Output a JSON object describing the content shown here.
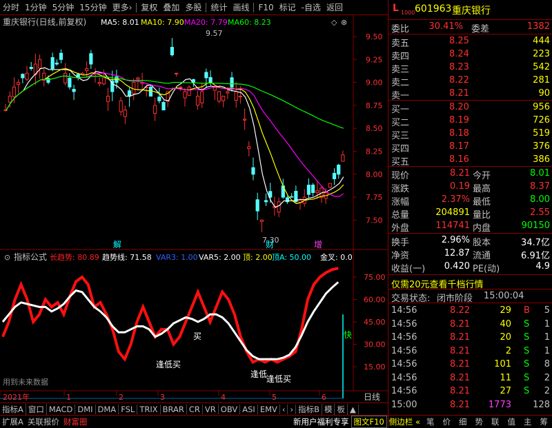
{
  "topbar": {
    "items": [
      "分时",
      "1分钟",
      "5分钟",
      "15分钟",
      "更多›",
      "复权",
      "叠加",
      "多股",
      "统计",
      "画线",
      "F10",
      "标记",
      "-自选",
      "返回"
    ]
  },
  "main": {
    "title": "重庆银行(日线,前复权)",
    "ma": [
      {
        "label": "MA5: 8.01",
        "color": "#ffffff"
      },
      {
        "label": "MA10: 7.90",
        "color": "#ffff00"
      },
      {
        "label": "MA20: 7.79",
        "color": "#ff00ff"
      },
      {
        "label": "MA60: 8.23",
        "color": "#00ff00"
      }
    ],
    "y_ticks": [
      "9.50",
      "9.25",
      "9.00",
      "8.75",
      "8.50",
      "8.25",
      "8.00",
      "7.75",
      "7.50"
    ],
    "high_label": "9.57",
    "low_label": "7.30",
    "markers": [
      "解",
      "财",
      "增"
    ]
  },
  "ind": {
    "title": "指标公式",
    "vals": [
      {
        "label": "长趋势: 80.89",
        "color": "#ff2020"
      },
      {
        "label": "趋势线: 71.58",
        "color": "#ffffff"
      },
      {
        "label": "VAR3: 1.00",
        "color": "#3060ff"
      },
      {
        "label": "VAR5: 2.00",
        "color": "#ffffff"
      },
      {
        "label": "顶: 2.00",
        "color": "#ffff00"
      },
      {
        "label": "顶A: 50.00",
        "color": "#00ffff"
      },
      {
        "label": "金叉: 0.0",
        "color": "#ffffff"
      }
    ],
    "y_ticks": [
      "75.00",
      "60.00",
      "45.00",
      "30.00",
      "15.00"
    ],
    "buy1": "逢低买",
    "buy2": "逢低",
    "buy3": "逢低买",
    "buy4": "买",
    "fast": "快",
    "note": "用到未来数据"
  },
  "xaxis": {
    "labels": [
      "2021年",
      "1",
      "2",
      "3",
      "4",
      "5",
      "6"
    ],
    "daily": "日线"
  },
  "indtabs": [
    "指标A",
    "窗口",
    "MACD",
    "DMI",
    "DMA",
    "FSL",
    "TRIX",
    "BRAR",
    "CR",
    "VR",
    "OBV",
    "ASI",
    "EMV",
    "‹",
    "›",
    "指标B",
    "模",
    "板",
    "▲"
  ],
  "status": {
    "left": [
      "扩展A",
      "关联报价",
      "财富圈"
    ],
    "promo": "新用户福利专享",
    "f10": "图文F10",
    "side": "侧边栏 «",
    "right": [
      "笔",
      "价",
      "细",
      "势",
      "联",
      "值",
      "主",
      "筹"
    ]
  },
  "quote": {
    "code": "601963",
    "name": "重庆银行",
    "wb_label": "委比",
    "wb": "30.41%",
    "wc_label": "委差",
    "wc": "1382",
    "asks": [
      {
        "l": "卖五",
        "p": "8.25",
        "v": "444"
      },
      {
        "l": "卖四",
        "p": "8.24",
        "v": "223"
      },
      {
        "l": "卖三",
        "p": "8.23",
        "v": "542"
      },
      {
        "l": "卖二",
        "p": "8.22",
        "v": "281"
      },
      {
        "l": "卖一",
        "p": "8.21",
        "v": "90"
      }
    ],
    "bids": [
      {
        "l": "买一",
        "p": "8.20",
        "v": "956"
      },
      {
        "l": "买二",
        "p": "8.19",
        "v": "726"
      },
      {
        "l": "买三",
        "p": "8.18",
        "v": "519"
      },
      {
        "l": "买四",
        "p": "8.17",
        "v": "376"
      },
      {
        "l": "买五",
        "p": "8.16",
        "v": "386"
      }
    ],
    "stats": [
      {
        "l1": "现价",
        "v1": "8.21",
        "c1": "#ff3030",
        "l2": "今开",
        "v2": "8.01",
        "c2": "#00ff00"
      },
      {
        "l1": "涨跌",
        "v1": "0.19",
        "c1": "#ff3030",
        "l2": "最高",
        "v2": "8.37",
        "c2": "#ff3030"
      },
      {
        "l1": "涨幅",
        "v1": "2.37%",
        "c1": "#ff3030",
        "l2": "最低",
        "v2": "8.00",
        "c2": "#00ff00"
      },
      {
        "l1": "总量",
        "v1": "204891",
        "c1": "#ffff00",
        "l2": "量比",
        "v2": "2.55",
        "c2": "#ff3030"
      },
      {
        "l1": "外盘",
        "v1": "114741",
        "c1": "#ff3030",
        "l2": "内盘",
        "v2": "90150",
        "c2": "#00ff00"
      }
    ],
    "stats2": [
      {
        "l1": "换手",
        "v1": "2.96%",
        "l2": "股本",
        "v2": "34.7亿"
      },
      {
        "l1": "净资",
        "v1": "12.87",
        "l2": "流通",
        "v2": "6.91亿"
      },
      {
        "l1": "收益(一)",
        "v1": "0.420",
        "l2": "PE(动)",
        "v2": "4.9"
      }
    ],
    "promo": "仅需20元查看千档行情",
    "state_label": "交易状态:",
    "state": "闭市阶段",
    "state_time": "15:00:04",
    "ticks": [
      {
        "t": "14:56",
        "p": "8.22",
        "v": "29",
        "s": "B",
        "n": "5"
      },
      {
        "t": "14:56",
        "p": "8.21",
        "v": "40",
        "s": "S",
        "n": "1"
      },
      {
        "t": "14:56",
        "p": "8.21",
        "v": "20",
        "s": "S",
        "n": "1"
      },
      {
        "t": "14:56",
        "p": "8.21",
        "v": "2",
        "s": "S",
        "n": "1"
      },
      {
        "t": "14:56",
        "p": "8.21",
        "v": "101",
        "s": "S",
        "n": "8"
      },
      {
        "t": "14:56",
        "p": "8.21",
        "v": "11",
        "s": "S",
        "n": "2"
      },
      {
        "t": "14:56",
        "p": "8.21",
        "v": "27",
        "s": "S",
        "n": "2"
      },
      {
        "t": "15:00",
        "p": "8.21",
        "v": "1773",
        "s": "",
        "n": "128"
      }
    ]
  }
}
